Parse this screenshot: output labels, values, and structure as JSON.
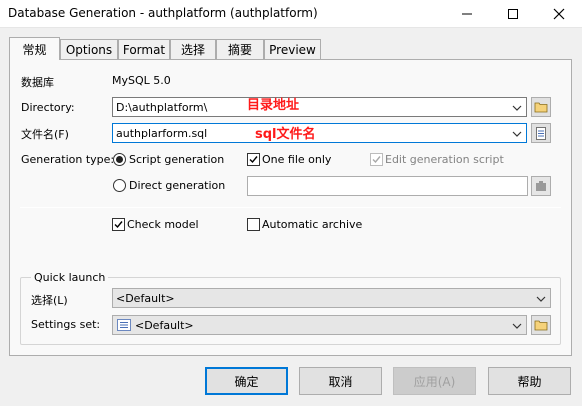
{
  "window": {
    "title": "Database Generation - authplatform (authplatform)"
  },
  "tabs": [
    {
      "label": "常规",
      "active": true
    },
    {
      "label": "Options"
    },
    {
      "label": "Format"
    },
    {
      "label": "选择"
    },
    {
      "label": "摘要"
    },
    {
      "label": "Preview"
    }
  ],
  "general": {
    "dbms_label": "数据库",
    "dbms_value": "MySQL 5.0",
    "directory_label": "Directory:",
    "directory_value": "D:\\authplatform\\",
    "directory_annotation": "目录地址",
    "filename_label": "文件名(F)",
    "filename_value": "authplarform.sql",
    "filename_annotation": "sql文件名",
    "gen_type_label": "Generation type:",
    "script_generation": "Script generation",
    "one_file_only": "One file only",
    "edit_generation_script": "Edit generation script",
    "direct_generation": "Direct generation",
    "check_model": "Check model",
    "automatic_archive": "Automatic archive"
  },
  "quick_launch": {
    "title": "Quick launch",
    "selection_label": "选择(L)",
    "selection_value": "<Default>",
    "settings_label": "Settings set:",
    "settings_value": "<Default>"
  },
  "buttons": {
    "ok": "确定",
    "cancel": "取消",
    "apply": "应用(A)",
    "help": "帮助"
  },
  "colors": {
    "annotation": "#ff1a1a",
    "focus": "#0078d7"
  }
}
